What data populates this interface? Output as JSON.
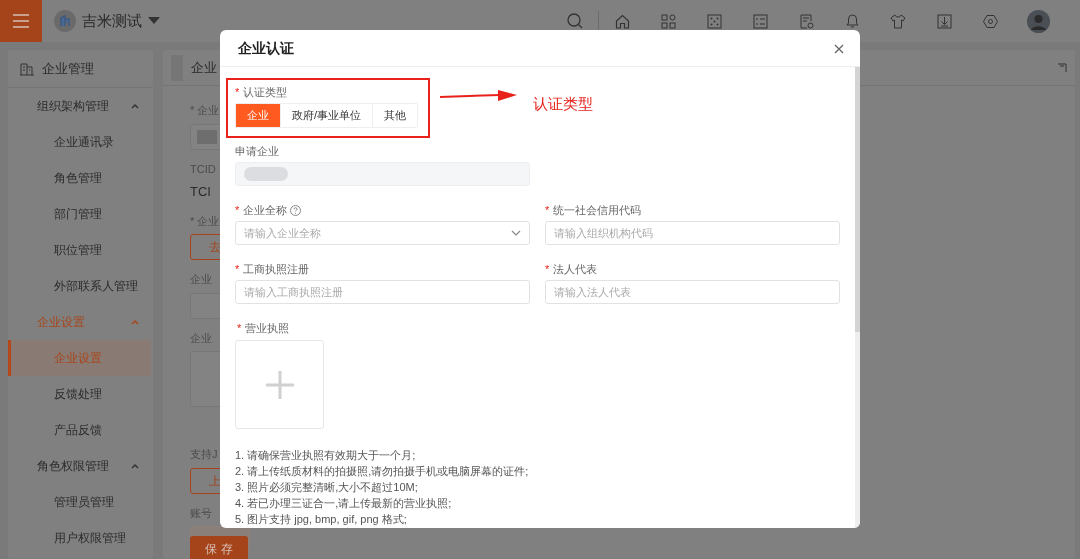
{
  "topbar": {
    "org_name": "吉米测试"
  },
  "sidebar": {
    "title": "企业管理",
    "groups": [
      {
        "label": "组织架构管理",
        "expanded": true,
        "children": [
          {
            "label": "企业通讯录",
            "selected": false
          },
          {
            "label": "角色管理",
            "selected": false
          },
          {
            "label": "部门管理",
            "selected": false
          },
          {
            "label": "职位管理",
            "selected": false
          },
          {
            "label": "外部联系人管理",
            "selected": false
          }
        ]
      },
      {
        "label": "企业设置",
        "expanded": true,
        "children": [
          {
            "label": "企业设置",
            "selected": true
          },
          {
            "label": "反馈处理",
            "selected": false
          },
          {
            "label": "产品反馈",
            "selected": false
          }
        ]
      },
      {
        "label": "角色权限管理",
        "expanded": true,
        "children": [
          {
            "label": "管理员管理",
            "selected": false
          },
          {
            "label": "用户权限管理",
            "selected": false
          }
        ]
      }
    ]
  },
  "main": {
    "tab": "企业",
    "items": [
      {
        "kind": "label",
        "text": "企业",
        "asterisk": "*"
      },
      {
        "kind": "redacted-input"
      },
      {
        "kind": "label",
        "text": "TCID"
      },
      {
        "kind": "value",
        "text": "TCI"
      },
      {
        "kind": "label",
        "text": "企业",
        "asterisk": "*"
      },
      {
        "kind": "outline-button",
        "text": "去"
      },
      {
        "kind": "label",
        "text": "企业"
      },
      {
        "kind": "input"
      },
      {
        "kind": "label",
        "text": "企业"
      },
      {
        "kind": "image"
      },
      {
        "kind": "hint",
        "text": "支持J"
      },
      {
        "kind": "outline-button",
        "text": "上"
      },
      {
        "kind": "label",
        "text": "账号"
      },
      {
        "kind": "tinted-box"
      }
    ],
    "save_button": "保 存"
  },
  "modal": {
    "title": "企业认证",
    "cert_type": {
      "label": "认证类型",
      "asterisk": "*",
      "options": [
        {
          "label": "企业",
          "selected": true
        },
        {
          "label": "政府/事业单位",
          "selected": false
        },
        {
          "label": "其他",
          "selected": false
        }
      ]
    },
    "applicant": {
      "label": "申请企业"
    },
    "fields": [
      {
        "label": "企业全称",
        "asterisk": "*",
        "help": true,
        "kind": "select",
        "placeholder": "请输入企业全称"
      },
      {
        "label": "统一社会信用代码",
        "asterisk": "*",
        "kind": "input",
        "placeholder": "请输入组织机构代码"
      },
      {
        "label": "工商执照注册",
        "asterisk": "*",
        "kind": "input",
        "placeholder": "请输入工商执照注册"
      },
      {
        "label": "法人代表",
        "asterisk": "*",
        "kind": "input",
        "placeholder": "请输入法人代表"
      }
    ],
    "license": {
      "label": "营业执照",
      "asterisk": "*"
    },
    "notes": [
      "1. 请确保营业执照有效期大于一个月;",
      "2. 请上传纸质材料的拍摄照,请勿拍摄手机或电脑屏幕的证件;",
      "3. 照片必须完整清晰,大小不超过10M;",
      "4. 若已办理三证合一,请上传最新的营业执照;",
      "5. 图片支持 jpg, bmp, gif, png 格式;"
    ]
  },
  "annotation": {
    "label": "认证类型"
  }
}
